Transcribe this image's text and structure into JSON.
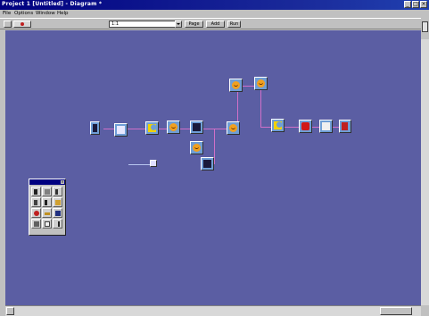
{
  "window": {
    "title": "Project 1 [Untitled] - Diagram *",
    "min_label": "_",
    "max_label": "□",
    "close_label": "×"
  },
  "menubar": {
    "items": [
      "File",
      "Options",
      "Window",
      "Help"
    ]
  },
  "toolbar": {
    "zoom_value": "1:1",
    "page_label": "Page",
    "add_label": "Add",
    "run_label": "Run"
  },
  "palette": {
    "tools": [
      "pointer-tool",
      "select-tool",
      "text-tool",
      "help-tool",
      "arrow-tool",
      "hand-tool",
      "record-tool",
      "link-tool",
      "paint-tool",
      "color-tool",
      "layer-tool",
      "pen-tool"
    ]
  },
  "colors": {
    "canvas": "#5b5ea3",
    "wire": "#d070c8",
    "node": "#6f9ed6",
    "titlebar": "#000080"
  }
}
